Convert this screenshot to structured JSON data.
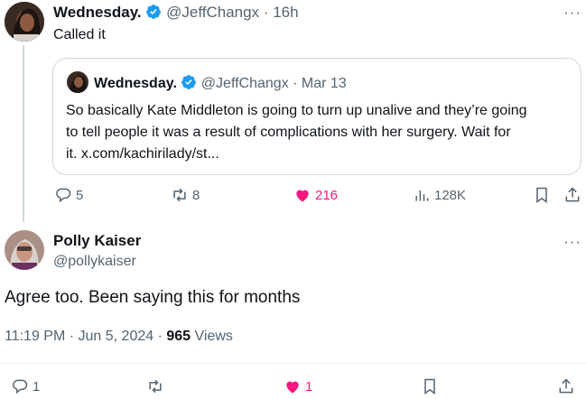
{
  "tweet": {
    "author_name": "Wednesday.",
    "handle": "@JeffChangx",
    "separator": "·",
    "time": "16h",
    "text": "Called it",
    "quote": {
      "author_name": "Wednesday.",
      "handle": "@JeffChangx",
      "separator": "·",
      "date": "Mar 13",
      "text_line1": "So basically Kate Middleton is going to turn up unalive and they’re going",
      "text_line2": "to tell people it was a result of complications with her surgery. Wait for",
      "text_line3": "it. x.com/kachirilady/st..."
    },
    "actions": {
      "replies": "5",
      "reposts": "8",
      "likes": "216",
      "views": "128K"
    },
    "colors": {
      "like_active": "#f91880",
      "verified": "#1d9bf0"
    }
  },
  "reply": {
    "author_name": "Polly Kaiser",
    "handle": "@pollykaiser",
    "text": "Agree too. Been saying this for months",
    "timestamp": "11:19 PM · Jun 5, 2024",
    "meta_separator": "·",
    "views_count": "965",
    "views_label": "Views",
    "actions": {
      "replies": "1",
      "likes": "1"
    }
  },
  "more_menu": "···"
}
